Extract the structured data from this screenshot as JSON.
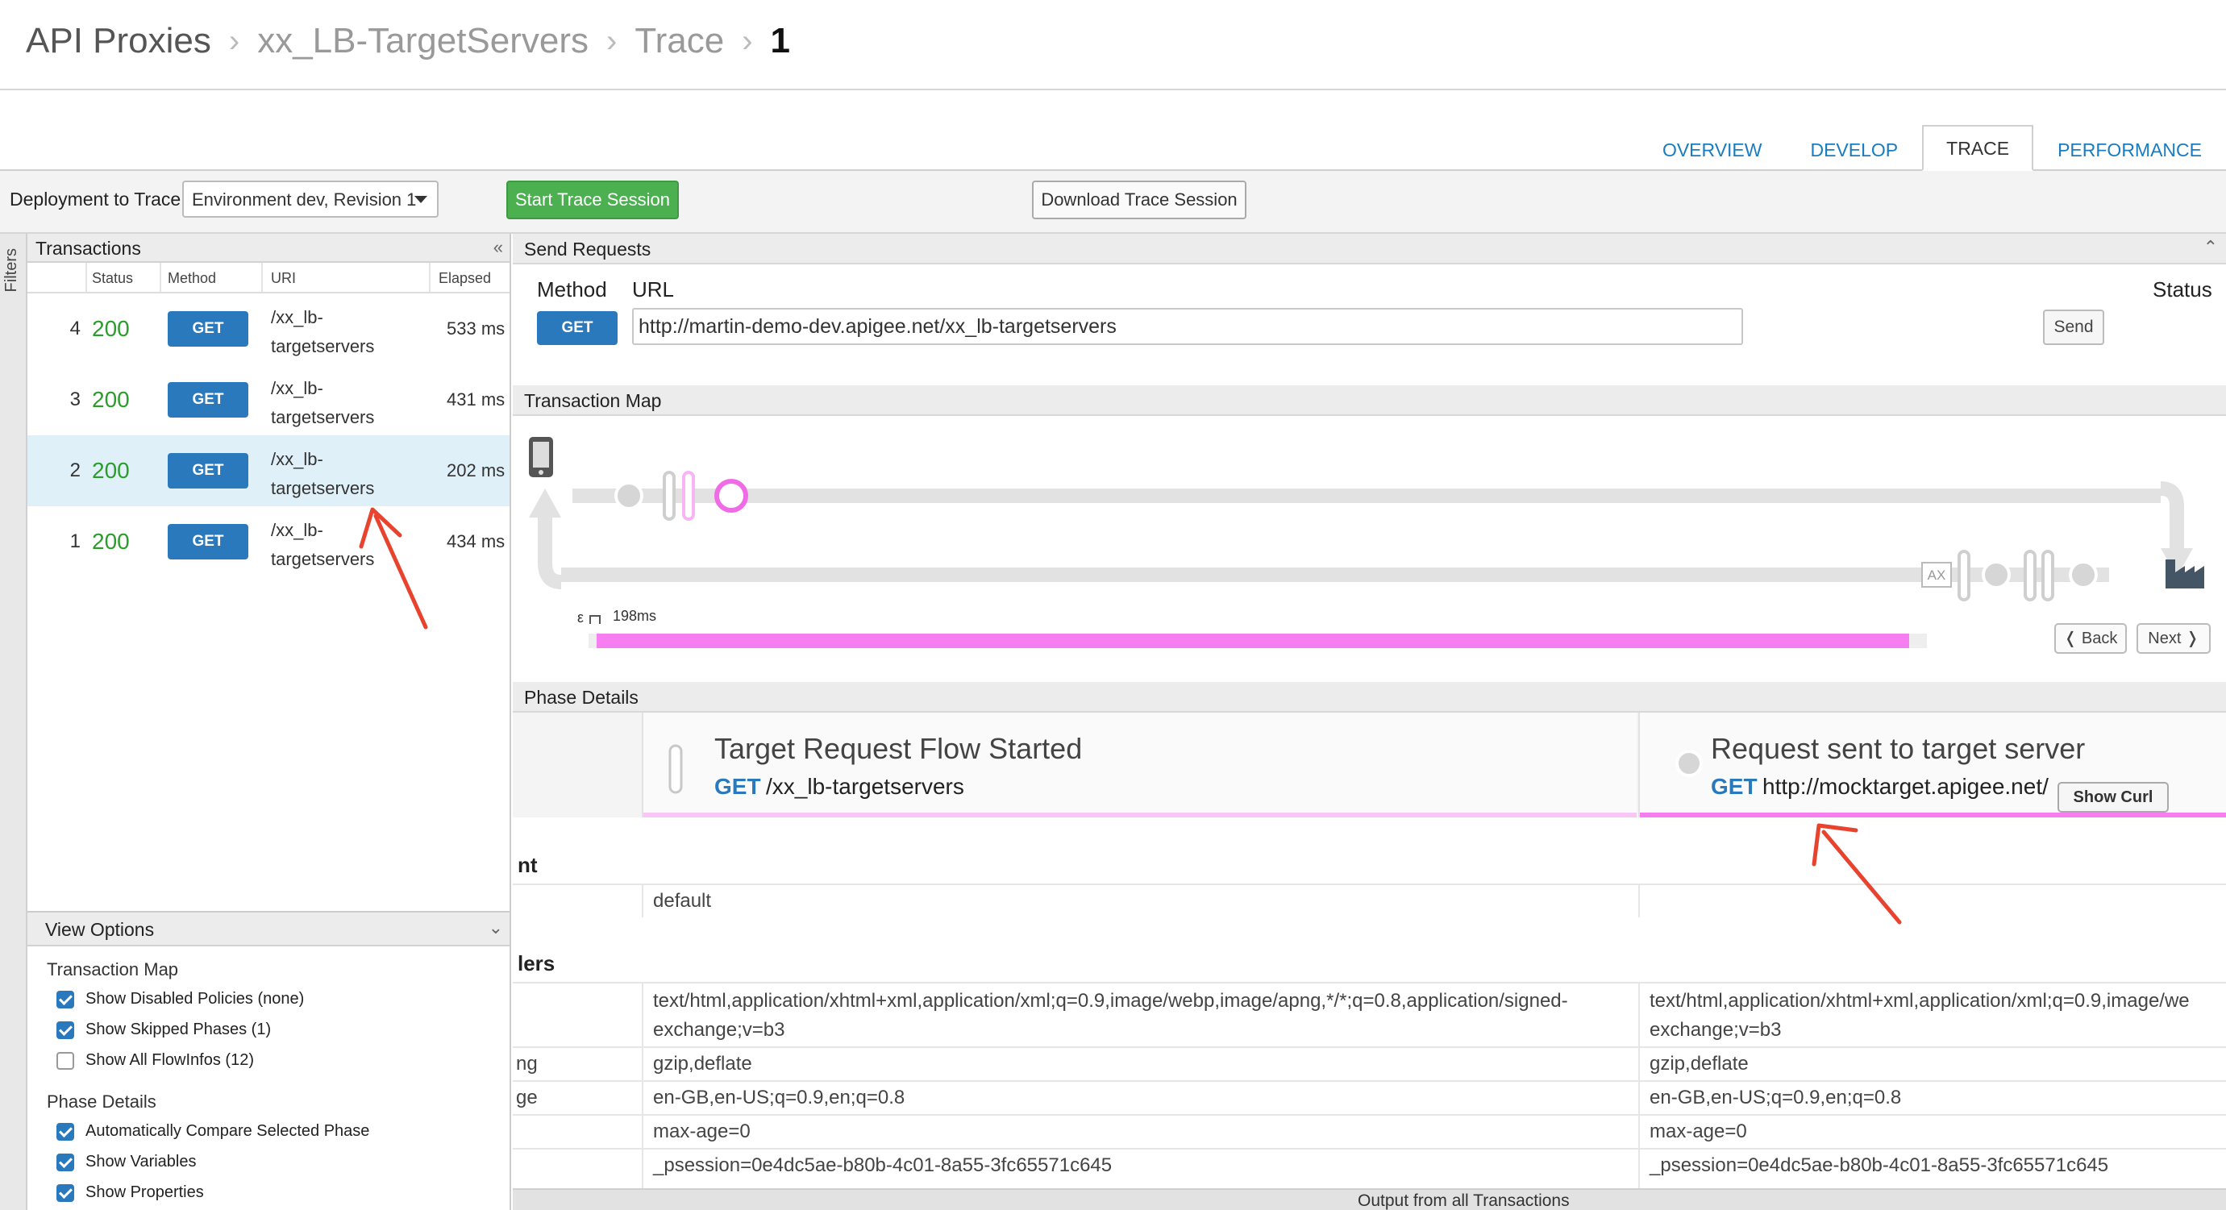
{
  "breadcrumb": {
    "items": [
      "API Proxies",
      "xx_LB-TargetServers",
      "Trace",
      "1"
    ]
  },
  "tabs": [
    {
      "label": "OVERVIEW",
      "active": false
    },
    {
      "label": "DEVELOP",
      "active": false
    },
    {
      "label": "TRACE",
      "active": true
    },
    {
      "label": "PERFORMANCE",
      "active": false
    }
  ],
  "toolbar": {
    "deploy_label": "Deployment to Trace",
    "deploy_value": "Environment dev, Revision 1",
    "start_label": "Start Trace Session",
    "download_label": "Download Trace Session"
  },
  "filters_label": "Filters",
  "transactions": {
    "title": "Transactions",
    "columns": {
      "status": "Status",
      "method": "Method",
      "uri": "URI",
      "elapsed": "Elapsed"
    },
    "rows": [
      {
        "num": "4",
        "status": "200",
        "method": "GET",
        "uri1": "/xx_lb-",
        "uri2": "targetservers",
        "elapsed": "533 ms",
        "selected": false
      },
      {
        "num": "3",
        "status": "200",
        "method": "GET",
        "uri1": "/xx_lb-",
        "uri2": "targetservers",
        "elapsed": "431 ms",
        "selected": false
      },
      {
        "num": "2",
        "status": "200",
        "method": "GET",
        "uri1": "/xx_lb-",
        "uri2": "targetservers",
        "elapsed": "202 ms",
        "selected": true
      },
      {
        "num": "1",
        "status": "200",
        "method": "GET",
        "uri1": "/xx_lb-",
        "uri2": "targetservers",
        "elapsed": "434 ms",
        "selected": false
      }
    ]
  },
  "view_options": {
    "title": "View Options",
    "map_section": "Transaction Map",
    "map_checks": [
      {
        "label": "Show Disabled Policies (none)",
        "checked": true
      },
      {
        "label": "Show Skipped Phases (1)",
        "checked": true
      },
      {
        "label": "Show All FlowInfos (12)",
        "checked": false
      }
    ],
    "phase_section": "Phase Details",
    "phase_checks": [
      {
        "label": "Automatically Compare Selected Phase",
        "checked": true
      },
      {
        "label": "Show Variables",
        "checked": true
      },
      {
        "label": "Show Properties",
        "checked": true
      }
    ]
  },
  "send_requests": {
    "title": "Send Requests",
    "method_label": "Method",
    "url_label": "URL",
    "status_label": "Status",
    "method": "GET",
    "url": "http://martin-demo-dev.apigee.net/xx_lb-targetservers",
    "send_label": "Send"
  },
  "transaction_map": {
    "title": "Transaction Map",
    "ax_label": "AX",
    "epsilon": "ε",
    "duration": "198ms",
    "back_label": "❬ Back",
    "next_label": "Next ❭",
    "accent": "#f77ef0"
  },
  "phase_details": {
    "title": "Phase Details",
    "phases": [
      {
        "title": "Target Request Flow Started",
        "verb": "GET",
        "path": "/xx_lb-targetservers"
      },
      {
        "title": "Request sent to target server",
        "verb": "GET",
        "path": "http://mocktarget.apigee.net/",
        "curl": "Show Curl"
      }
    ]
  },
  "detail": {
    "group1": "nt",
    "group1_rows": [
      {
        "key": "",
        "v1": "default",
        "v2": ""
      }
    ],
    "group2": "lers",
    "group2_rows": [
      {
        "key": "",
        "v1": "text/html,application/xhtml+xml,application/xml;q=0.9,image/webp,image/apng,*/*;q=0.8,application/signed-exchange;v=b3",
        "v2": "text/html,application/xhtml+xml,application/xml;q=0.9,image/we exchange;v=b3"
      },
      {
        "key": "ng",
        "v1": "gzip,deflate",
        "v2": "gzip,deflate"
      },
      {
        "key": "ge",
        "v1": "en-GB,en-US;q=0.9,en;q=0.8",
        "v2": "en-GB,en-US;q=0.9,en;q=0.8"
      },
      {
        "key": "",
        "v1": "max-age=0",
        "v2": "max-age=0"
      },
      {
        "key": "",
        "v1": "_psession=0e4dc5ae-b80b-4c01-8a55-3fc65571c645",
        "v2": "_psession=0e4dc5ae-b80b-4c01-8a55-3fc65571c645"
      }
    ],
    "footer": "Output from all Transactions"
  },
  "colors": {
    "link_blue": "#1a7cc0",
    "button_blue": "#2b79bd",
    "status_green": "#2a9d2a",
    "start_green": "#4caf50",
    "trace_pink": "#f77ef0",
    "annotation_red": "#e8432e"
  }
}
